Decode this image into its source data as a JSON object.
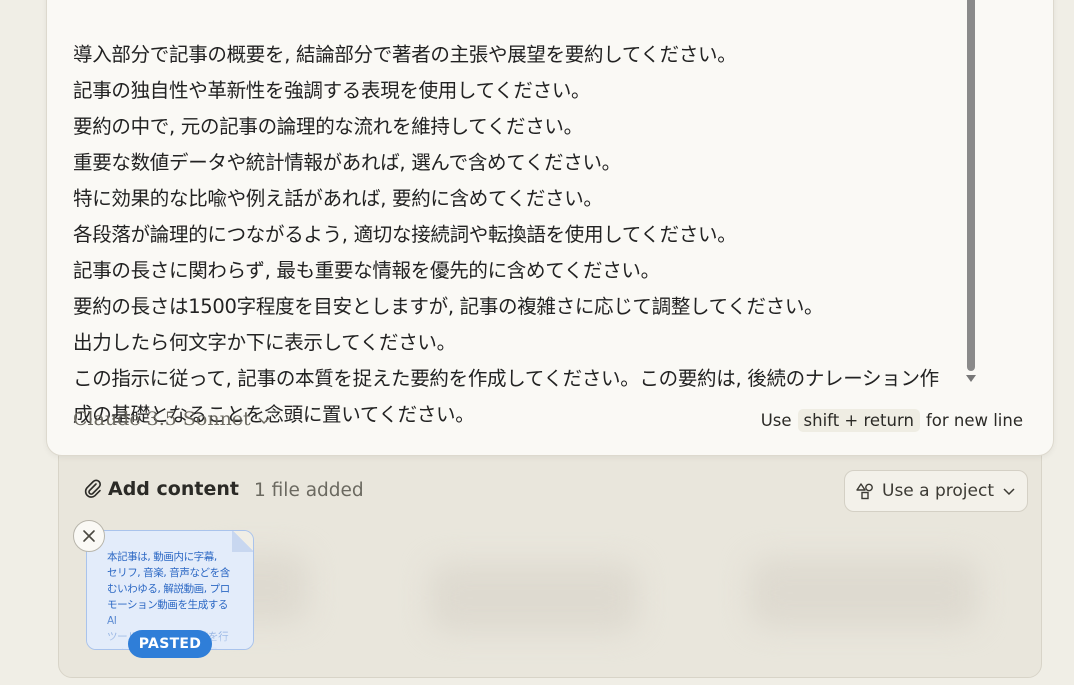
{
  "prompt_lines": [
    "導入部分で記事の概要を, 結論部分で著者の主張や展望を要約してください。",
    "記事の独自性や革新性を強調する表現を使用してください。",
    "要約の中で, 元の記事の論理的な流れを維持してください。",
    "重要な数値データや統計情報があれば, 選んで含めてください。",
    "特に効果的な比喩や例え話があれば, 要約に含めてください。",
    "各段落が論理的につながるよう, 適切な接続詞や転換語を使用してください。",
    "記事の長さに関わらず, 最も重要な情報を優先的に含めてください。",
    "要約の長さは1500字程度を目安としますが, 記事の複雑さに応じて調整してください。",
    "出力したら何文字か下に表示してください。",
    "この指示に従って, 記事の本質を捉えた要約を作成してください。この要約は, 後続のナレーション作",
    "成の基礎となることを念頭に置いてください。"
  ],
  "model_selector": {
    "label": "Claude 3.5 Sonnet"
  },
  "hint": {
    "prefix": "Use",
    "keys": "shift + return",
    "suffix": "for new line"
  },
  "tray": {
    "add_content_label": "Add content",
    "file_count": "1 file added",
    "project_button_label": "Use a project"
  },
  "attachment": {
    "preview_text": "本記事は, 動画内に字幕,\nセリフ, 音楽, 音声などを含\nむいわゆる, 解説動画, プロ\nモーション動画を生成するAI\nツールの使用感の比較を行\nいます。まずは概要と記",
    "badge": "PASTED"
  },
  "colors": {
    "badge": "#2f7ed8",
    "file_card_bg": "#e3ecfa",
    "page_bg": "#f0eee6"
  }
}
